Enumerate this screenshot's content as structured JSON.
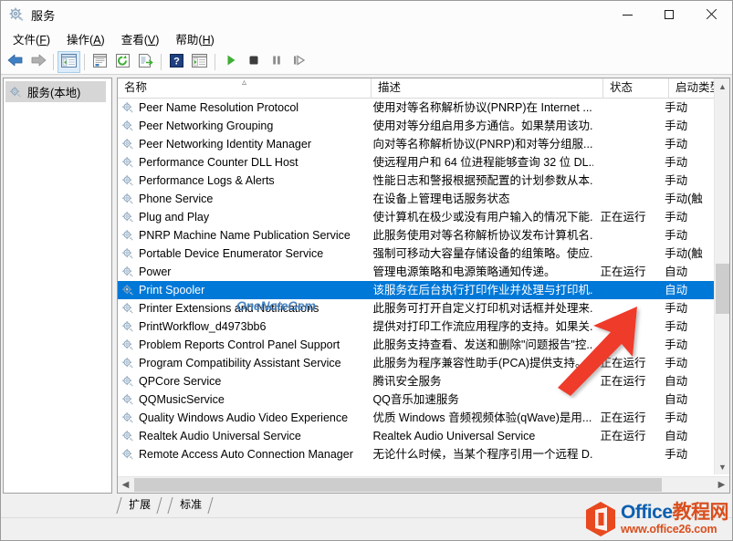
{
  "window": {
    "title": "服务",
    "icon": "services-gear-icon",
    "minimize_label": "最小化",
    "maximize_label": "最大化",
    "close_label": "关闭"
  },
  "menubar": {
    "items": [
      {
        "label": "文件(F)",
        "text": "文件",
        "accel": "F"
      },
      {
        "label": "操作(A)",
        "text": "操作",
        "accel": "A"
      },
      {
        "label": "查看(V)",
        "text": "查看",
        "accel": "V"
      },
      {
        "label": "帮助(H)",
        "text": "帮助",
        "accel": "H"
      }
    ]
  },
  "toolbar": {
    "buttons": [
      {
        "name": "back-icon",
        "pressed": false
      },
      {
        "name": "forward-icon",
        "pressed": false
      },
      {
        "name": "show-hide-console-tree-icon",
        "pressed": true
      },
      {
        "name": "properties-icon",
        "pressed": false
      },
      {
        "name": "refresh-icon",
        "pressed": false
      },
      {
        "name": "export-list-icon",
        "pressed": false
      },
      {
        "name": "help-icon",
        "pressed": false
      },
      {
        "name": "show-action-pane-icon",
        "pressed": false
      },
      {
        "name": "start-service-icon",
        "pressed": false
      },
      {
        "name": "stop-service-icon",
        "pressed": false
      },
      {
        "name": "pause-service-icon",
        "pressed": false
      },
      {
        "name": "restart-service-icon",
        "pressed": false
      }
    ]
  },
  "tree": {
    "root": {
      "label": "服务(本地)",
      "icon": "services-gear-icon",
      "selected": true
    }
  },
  "list": {
    "columns": [
      {
        "key": "name",
        "label": "名称",
        "sorted": true,
        "sort_caret": "︿"
      },
      {
        "key": "description",
        "label": "描述"
      },
      {
        "key": "status",
        "label": "状态"
      },
      {
        "key": "startup",
        "label": "启动类型"
      }
    ],
    "rows": [
      {
        "name": "Peer Name Resolution Protocol",
        "description": "使用对等名称解析协议(PNRP)在 Internet ...",
        "status": "",
        "startup": "手动",
        "selected": false
      },
      {
        "name": "Peer Networking Grouping",
        "description": "使用对等分组启用多方通信。如果禁用该功...",
        "status": "",
        "startup": "手动",
        "selected": false
      },
      {
        "name": "Peer Networking Identity Manager",
        "description": "向对等名称解析协议(PNRP)和对等分组服...",
        "status": "",
        "startup": "手动",
        "selected": false
      },
      {
        "name": "Performance Counter DLL Host",
        "description": "使远程用户和 64 位进程能够查询 32 位 DL...",
        "status": "",
        "startup": "手动",
        "selected": false
      },
      {
        "name": "Performance Logs & Alerts",
        "description": "性能日志和警报根据预配置的计划参数从本...",
        "status": "",
        "startup": "手动",
        "selected": false
      },
      {
        "name": "Phone Service",
        "description": "在设备上管理电话服务状态",
        "status": "",
        "startup": "手动(触",
        "selected": false
      },
      {
        "name": "Plug and Play",
        "description": "使计算机在极少或没有用户输入的情况下能...",
        "status": "正在运行",
        "startup": "手动",
        "selected": false
      },
      {
        "name": "PNRP Machine Name Publication Service",
        "description": "此服务使用对等名称解析协议发布计算机名...",
        "status": "",
        "startup": "手动",
        "selected": false
      },
      {
        "name": "Portable Device Enumerator Service",
        "description": "强制可移动大容量存储设备的组策略。使应...",
        "status": "",
        "startup": "手动(触",
        "selected": false
      },
      {
        "name": "Power",
        "description": "管理电源策略和电源策略通知传递。",
        "status": "正在运行",
        "startup": "自动",
        "selected": false
      },
      {
        "name": "Print Spooler",
        "description": "该服务在后台执行打印作业并处理与打印机...",
        "status": "",
        "startup": "自动",
        "selected": true
      },
      {
        "name": "Printer Extensions and Notifications",
        "description": "此服务可打开自定义打印机对话框并处理来...",
        "status": "",
        "startup": "手动",
        "selected": false
      },
      {
        "name": "PrintWorkflow_d4973bb6",
        "description": "提供对打印工作流应用程序的支持。如果关...",
        "status": "",
        "startup": "手动",
        "selected": false
      },
      {
        "name": "Problem Reports Control Panel Support",
        "description": "此服务支持查看、发送和删除\"问题报告\"控...",
        "status": "",
        "startup": "手动",
        "selected": false
      },
      {
        "name": "Program Compatibility Assistant Service",
        "description": "此服务为程序兼容性助手(PCA)提供支持。P...",
        "status": "正在运行",
        "startup": "手动",
        "selected": false
      },
      {
        "name": "QPCore Service",
        "description": "腾讯安全服务",
        "status": "正在运行",
        "startup": "自动",
        "selected": false
      },
      {
        "name": "QQMusicService",
        "description": "QQ音乐加速服务",
        "status": "",
        "startup": "自动",
        "selected": false
      },
      {
        "name": "Quality Windows Audio Video Experience",
        "description": "优质 Windows 音频视频体验(qWave)是用...",
        "status": "正在运行",
        "startup": "手动",
        "selected": false
      },
      {
        "name": "Realtek Audio Universal Service",
        "description": "Realtek Audio Universal Service",
        "status": "正在运行",
        "startup": "自动",
        "selected": false
      },
      {
        "name": "Remote Access Auto Connection Manager",
        "description": "无论什么时候，当某个程序引用一个远程 D...",
        "status": "",
        "startup": "手动",
        "selected": false
      }
    ]
  },
  "tabs": [
    {
      "label": "扩展",
      "active": false
    },
    {
      "label": "标准",
      "active": true
    }
  ],
  "watermarks": {
    "onenotegem": "OneNoteGem",
    "office_title": "Office",
    "office_title_cn": "教程网",
    "office_url": "www.office26.com"
  },
  "annotation": {
    "arrow": "red-arrow-pointing-to-print-spooler",
    "color": "#ef3b2c"
  },
  "colors": {
    "selection": "#0078d7",
    "accent_red": "#ef3b2c",
    "office_blue": "#0b5fb0",
    "office_orange": "#d94f1e"
  }
}
